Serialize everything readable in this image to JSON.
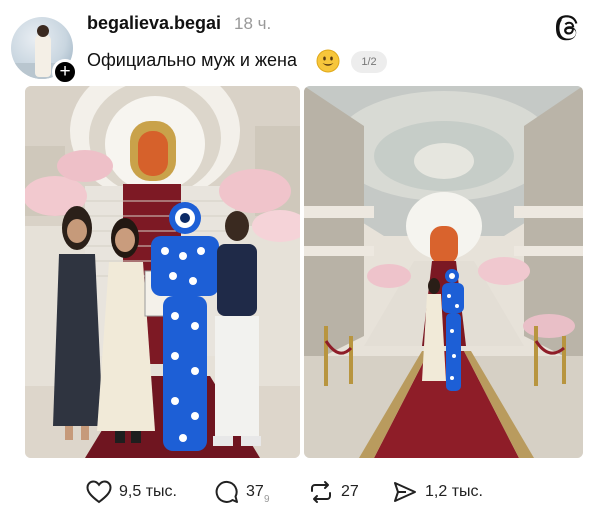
{
  "header": {
    "username": "begalieva.begai",
    "time_ago": "18 ч.",
    "app_icon": "threads-icon"
  },
  "post": {
    "text": "Официально муж и жена",
    "emoji": "smiling-face-emoji",
    "counter": "1/2"
  },
  "actions": {
    "likes": "9,5 тыс.",
    "replies": "37",
    "reposts": "27",
    "shares": "1,2 тыс.",
    "replies_sub": "9"
  },
  "colors": {
    "carpet": "#8e1d28",
    "evil_eye_blue": "#1d5fd6",
    "marble": "#e9e4dc"
  }
}
